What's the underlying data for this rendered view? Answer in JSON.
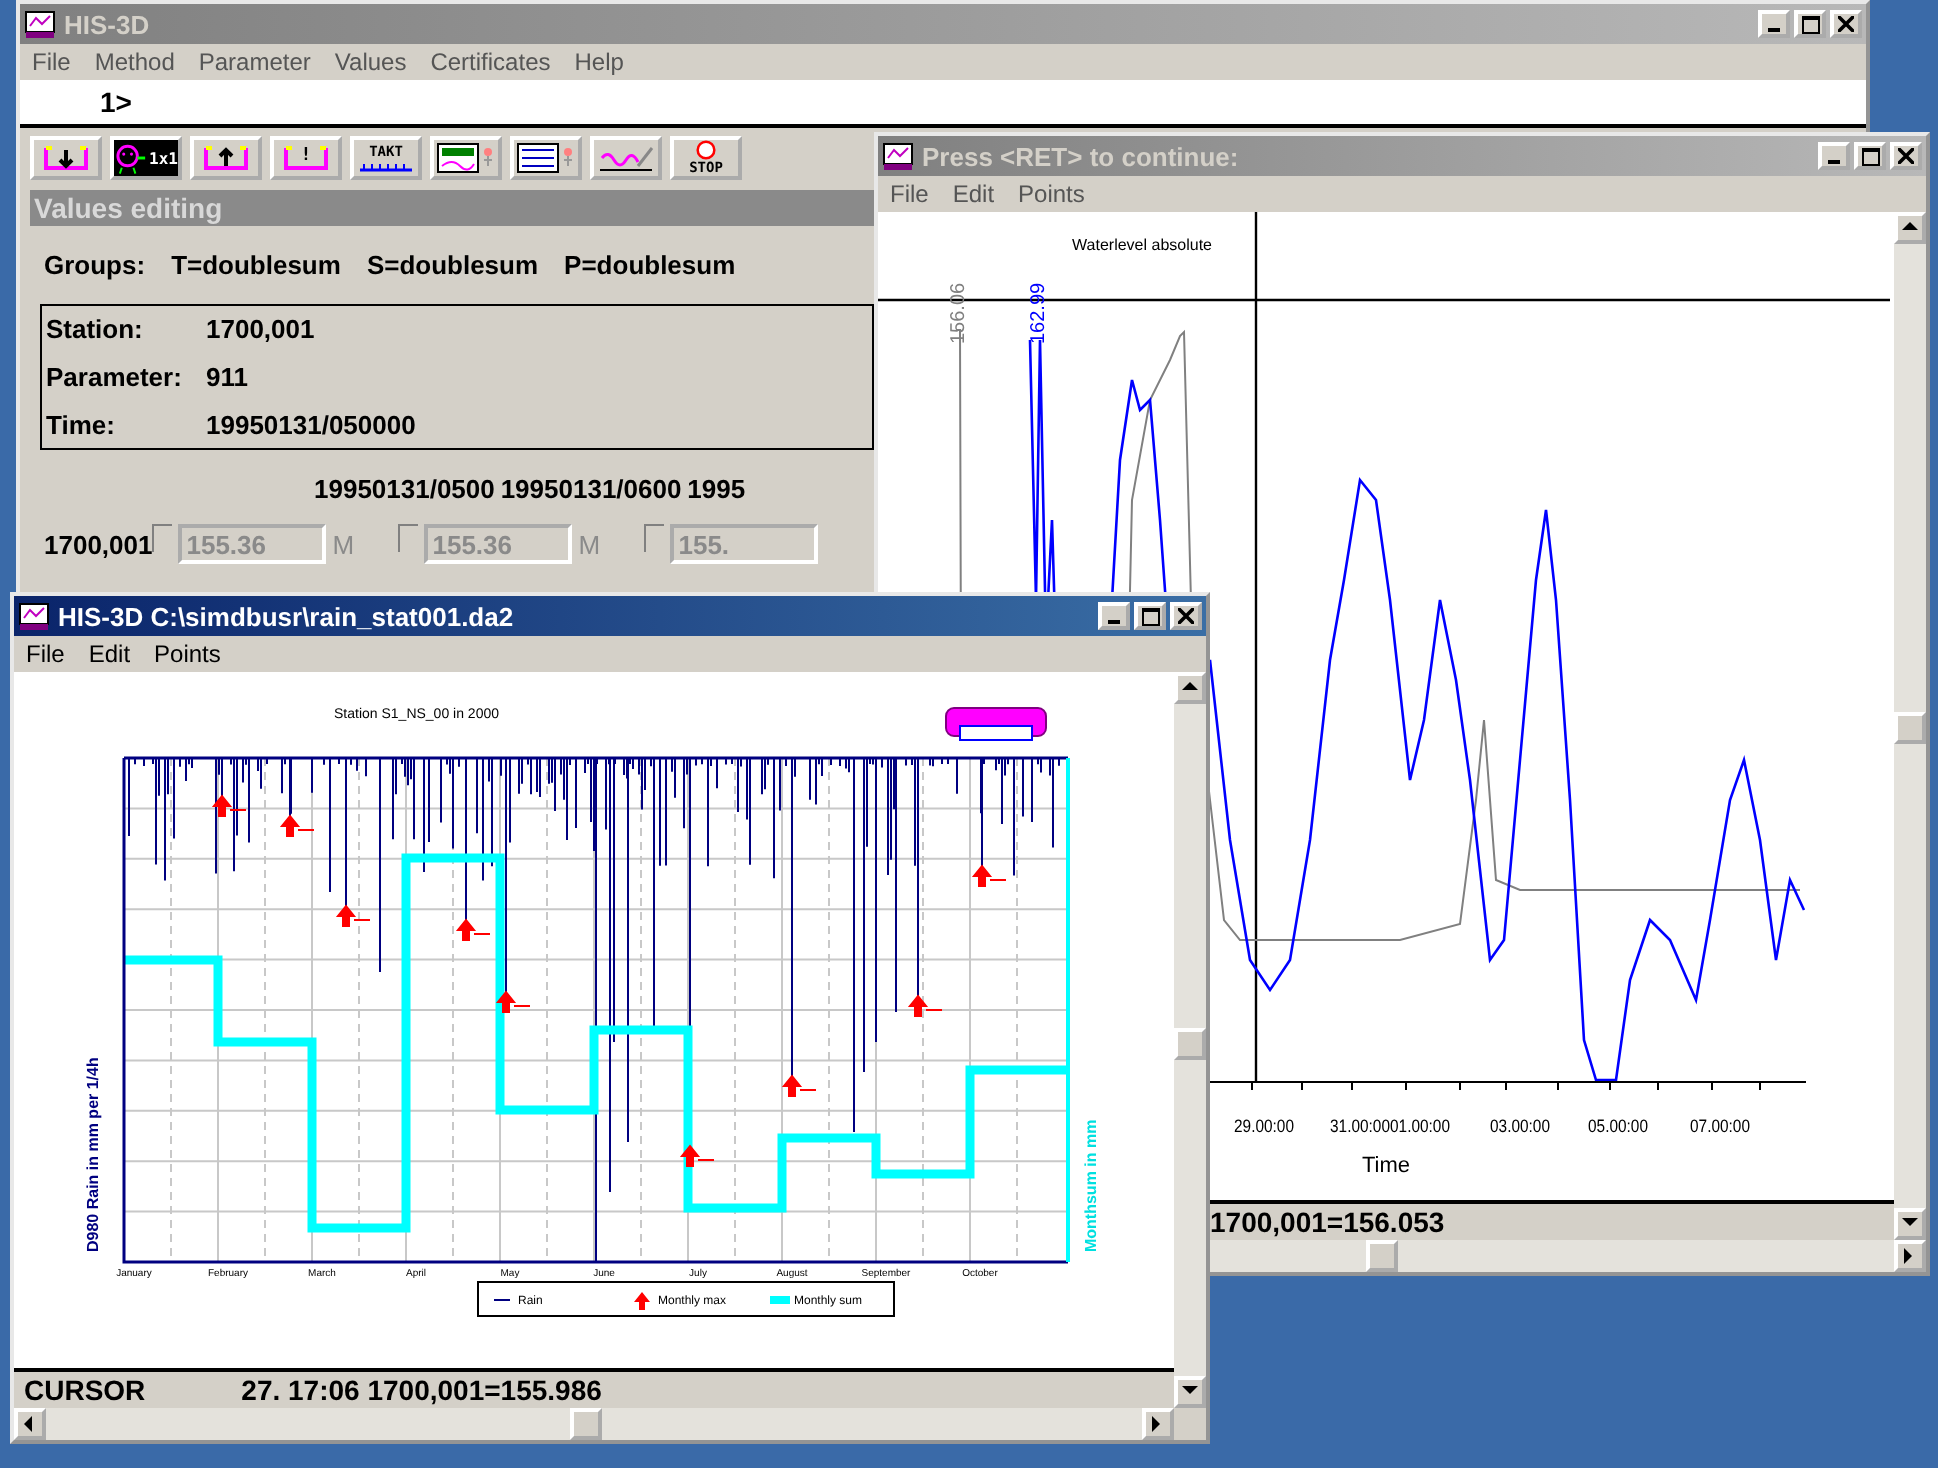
{
  "main_window": {
    "title": "HIS-3D",
    "active": false,
    "menu": [
      "File",
      "Method",
      "Parameter",
      "Values",
      "Certificates",
      "Help"
    ],
    "command_prompt": "1>",
    "toolbar": [
      {
        "kind": "down"
      },
      {
        "kind": "face",
        "label": "1x1"
      },
      {
        "kind": "up"
      },
      {
        "kind": "alert",
        "label": "!"
      },
      {
        "kind": "takt",
        "label": "TAKT"
      },
      {
        "kind": "values"
      },
      {
        "kind": "table"
      },
      {
        "kind": "graph"
      },
      {
        "kind": "stop",
        "label": "STOP"
      }
    ],
    "values_editing": {
      "title": "Values editing",
      "groups": [
        "Groups:",
        "T=doublesum",
        "S=doublesum",
        "P=doublesum"
      ],
      "info": [
        {
          "label": "Station:",
          "value": "1700,001"
        },
        {
          "label": "Parameter:",
          "value": "911"
        },
        {
          "label": "Time:",
          "value": "19950131/050000"
        }
      ],
      "columns": [
        "19950131/0500",
        "19950131/0600",
        "1995"
      ],
      "rows": [
        {
          "station": "1700,001",
          "cells": [
            {
              "value": "155.36",
              "flag": "M",
              "disabled": true,
              "checked": false
            },
            {
              "value": "155.36",
              "flag": "M",
              "disabled": true,
              "checked": false
            },
            {
              "value": "155.",
              "disabled": true,
              "checked": false
            }
          ]
        }
      ]
    }
  },
  "press_window": {
    "title": "Press <RET> to continue:",
    "active": false,
    "menu": [
      "File",
      "Edit",
      "Points"
    ],
    "chart": {
      "title": "Waterlevel absolute",
      "series_labels": [
        {
          "text": "156.06",
          "color": "#808080"
        },
        {
          "text": "162.99",
          "color": "#0000ff"
        }
      ],
      "x_labels": [
        "29.00:00",
        "31.00:00",
        "01.00:00",
        "03.00:00",
        "05.00:00",
        "07.00:00"
      ],
      "x_title": "Time"
    },
    "status": "1700,001=156.053"
  },
  "rain_window": {
    "title": "HIS-3D C:\\simdbusr\\rain_stat001.da2",
    "active": true,
    "menu": [
      "File",
      "Edit",
      "Points"
    ],
    "chart": {
      "title": "Station S1_NS_00 in 2000",
      "y_left_title": "D980 Rain in mm per 1/4h",
      "y_right_title": "Monthsum in mm",
      "months": [
        "January",
        "February",
        "March",
        "April",
        "May",
        "June",
        "July",
        "August",
        "September",
        "October"
      ],
      "legend": [
        {
          "kind": "line",
          "label": "Rain"
        },
        {
          "kind": "arrow",
          "label": "Monthly max"
        },
        {
          "kind": "band",
          "label": "Monthly sum"
        }
      ]
    },
    "status": {
      "label": "CURSOR",
      "value": "27. 17:06 1700,001=155.986"
    }
  }
}
